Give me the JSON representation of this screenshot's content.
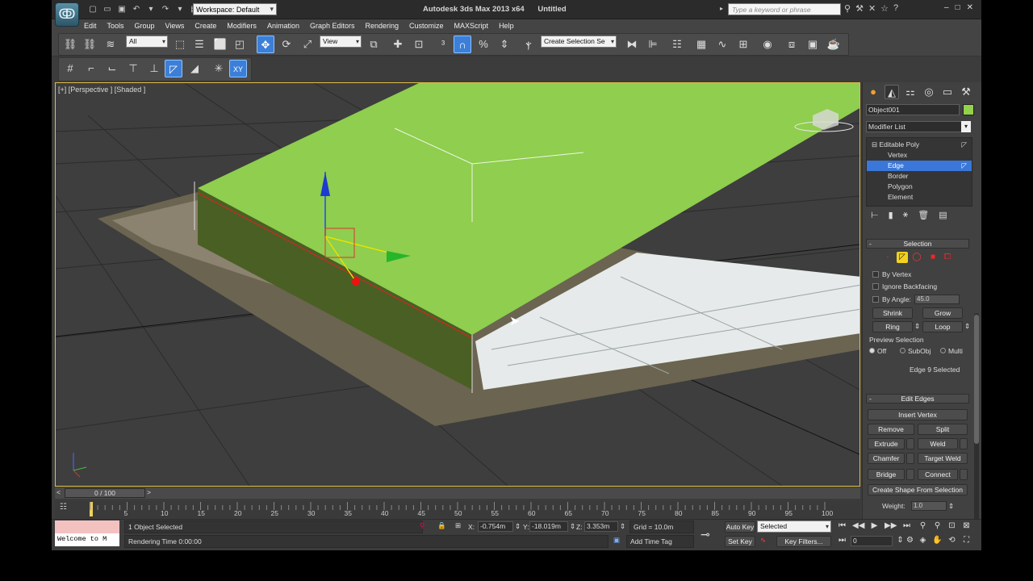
{
  "window": {
    "title": "Autodesk 3ds Max  2013 x64",
    "document": "Untitled",
    "workspace": "Workspace: Default",
    "search_placeholder": "Type a keyword or phrase"
  },
  "menus": [
    "Edit",
    "Tools",
    "Group",
    "Views",
    "Create",
    "Modifiers",
    "Animation",
    "Graph Editors",
    "Rendering",
    "Customize",
    "MAXScript",
    "Help"
  ],
  "toolbar": {
    "selection_filter": "All",
    "ref_coord": "View",
    "named_selection": "Create Selection Se"
  },
  "viewport": {
    "label": "[+] [Perspective ] [Shaded ]",
    "viewcube_label": "top",
    "colors": {
      "roof": "#8fce4e",
      "wall": "#4a5f24",
      "ground": "#3f3f3f"
    }
  },
  "command_panel": {
    "object_name": "Object001",
    "object_color": "#93d24b",
    "modifier_list": "Modifier List",
    "stack": [
      {
        "label": "Editable Poly",
        "indent": 0,
        "selected": false
      },
      {
        "label": "Vertex",
        "indent": 1,
        "selected": false
      },
      {
        "label": "Edge",
        "indent": 1,
        "selected": true
      },
      {
        "label": "Border",
        "indent": 1,
        "selected": false
      },
      {
        "label": "Polygon",
        "indent": 1,
        "selected": false
      },
      {
        "label": "Element",
        "indent": 1,
        "selected": false
      }
    ],
    "selection": {
      "title": "Selection",
      "by_vertex": "By Vertex",
      "ignore_backfacing": "Ignore Backfacing",
      "by_angle": "By Angle:",
      "angle_value": "45.0",
      "shrink": "Shrink",
      "grow": "Grow",
      "ring": "Ring",
      "loop": "Loop",
      "preview_title": "Preview Selection",
      "preview_off": "Off",
      "preview_subobj": "SubObj",
      "preview_multi": "Multi",
      "status": "Edge 9 Selected"
    },
    "edit_edges": {
      "title": "Edit Edges",
      "insert_vertex": "Insert Vertex",
      "remove": "Remove",
      "split": "Split",
      "extrude": "Extrude",
      "weld": "Weld",
      "chamfer": "Chamfer",
      "target_weld": "Target Weld",
      "bridge": "Bridge",
      "connect": "Connect",
      "create_shape": "Create Shape From Selection",
      "weight_label": "Weight:",
      "weight_value": "1.0"
    }
  },
  "timeline": {
    "frame": "0 / 100",
    "ticks": [
      "5",
      "10",
      "15",
      "20",
      "25",
      "30",
      "35",
      "40",
      "45",
      "50",
      "55",
      "60",
      "65",
      "70",
      "75",
      "80",
      "85",
      "90",
      "95",
      "100"
    ]
  },
  "status_bar": {
    "listener_text": "Welcome to M",
    "objects_selected": "1 Object Selected",
    "prompt": "Rendering Time  0:00:00",
    "x_label": "X:",
    "x_value": "-0.754m",
    "y_label": "Y:",
    "y_value": "-18.019m",
    "z_label": "Z:",
    "z_value": "3.353m",
    "grid": "Grid = 10.0m",
    "add_time_tag": "Add Time Tag",
    "auto_key": "Auto Key",
    "set_key": "Set Key",
    "key_mode": "Selected",
    "key_filters": "Key Filters...",
    "current_frame": "0"
  }
}
